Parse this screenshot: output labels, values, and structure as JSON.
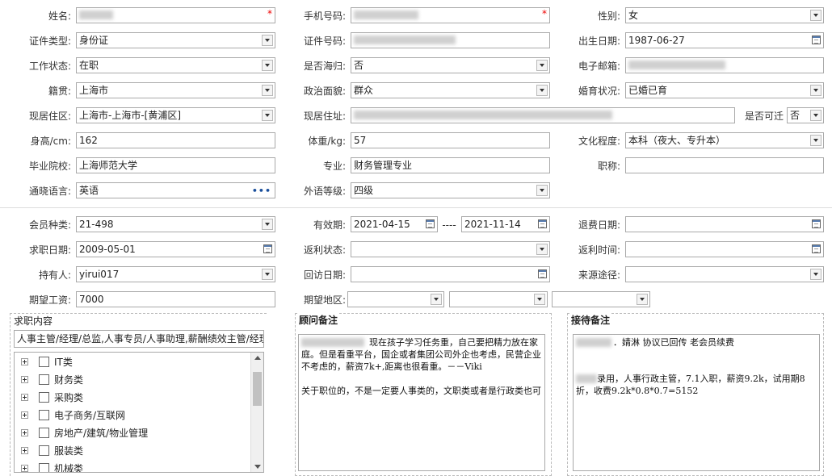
{
  "basic": {
    "name": {
      "label": "姓名:",
      "value": ""
    },
    "phone": {
      "label": "手机号码:",
      "value": ""
    },
    "gender": {
      "label": "性别:",
      "value": "女"
    },
    "id_type": {
      "label": "证件类型:",
      "value": "身份证"
    },
    "id_number": {
      "label": "证件号码:",
      "value": ""
    },
    "birth_date": {
      "label": "出生日期:",
      "value": "1987-06-27"
    },
    "work_status": {
      "label": "工作状态:",
      "value": "在职"
    },
    "overseas": {
      "label": "是否海归:",
      "value": "否"
    },
    "email": {
      "label": "电子邮箱:",
      "value": ""
    },
    "native_place": {
      "label": "籍贯:",
      "value": "上海市"
    },
    "political": {
      "label": "政治面貌:",
      "value": "群众"
    },
    "marital": {
      "label": "婚育状况:",
      "value": "已婚已育"
    },
    "residence_area": {
      "label": "现居住区:",
      "value": "上海市-上海市-[黄浦区]"
    },
    "address": {
      "label": "现居住址:",
      "value": ""
    },
    "can_relocate": {
      "label": "是否可迁",
      "value": "否"
    },
    "height": {
      "label": "身高/cm:",
      "value": "162"
    },
    "weight": {
      "label": "体重/kg:",
      "value": "57"
    },
    "education": {
      "label": "文化程度:",
      "value": "本科（夜大、专升本）"
    },
    "school": {
      "label": "毕业院校:",
      "value": "上海师范大学"
    },
    "major": {
      "label": "专业:",
      "value": "财务管理专业"
    },
    "title": {
      "label": "职称:",
      "value": ""
    },
    "languages": {
      "label": "通晓语言:",
      "value": "英语"
    },
    "language_level": {
      "label": "外语等级:",
      "value": "四级"
    }
  },
  "member": {
    "type": {
      "label": "会员种类:",
      "value": "21-498"
    },
    "valid_period": {
      "label": "有效期:",
      "start": "2021-04-15",
      "sep": "----",
      "end": "2021-11-14"
    },
    "refund_date": {
      "label": "退费日期:",
      "value": ""
    },
    "job_date": {
      "label": "求职日期:",
      "value": "2009-05-01"
    },
    "rebate_status": {
      "label": "返利状态:",
      "value": ""
    },
    "rebate_time": {
      "label": "返利时间:",
      "value": ""
    },
    "holder": {
      "label": "持有人:",
      "value": "yirui017"
    },
    "revisit_date": {
      "label": "回访日期:",
      "value": ""
    },
    "source": {
      "label": "来源途径:",
      "value": ""
    },
    "expected_salary": {
      "label": "期望工资:",
      "value": "7000"
    },
    "expected_region": {
      "label": "期望地区:",
      "value1": "",
      "value2": "",
      "value3": ""
    }
  },
  "job_content": {
    "title": "求职内容",
    "selected": "人事主管/经理/总监,人事专员/人事助理,薪酬绩效主管/经理",
    "categories": [
      "IT类",
      "财务类",
      "采购类",
      "电子商务/互联网",
      "房地产/建筑/物业管理",
      "服装类",
      "机械类"
    ]
  },
  "advisor_notes": {
    "title": "顾问备注",
    "text": "现在孩子学习任务重，自己要把精力放在家庭。但是看重平台，国企或者集团公司外企也考虑，民营企业不考虑的，薪资7k+,距离也很看重。－－Viki\n\n关于职位的，不是一定要人事类的，文职类或者是行政类也可"
  },
  "reception_notes": {
    "title": "接待备注",
    "line1": "．婧淋 协议已回传 老会员续费",
    "line2": "录用，人事行政主管，7.1入职，薪资9.2k，试用期8折，收费9.2k*0.8*0.7=5152"
  },
  "colors": {
    "required": "#e00000",
    "border": "#a9a9a9",
    "accent": "#1a4f9c"
  }
}
